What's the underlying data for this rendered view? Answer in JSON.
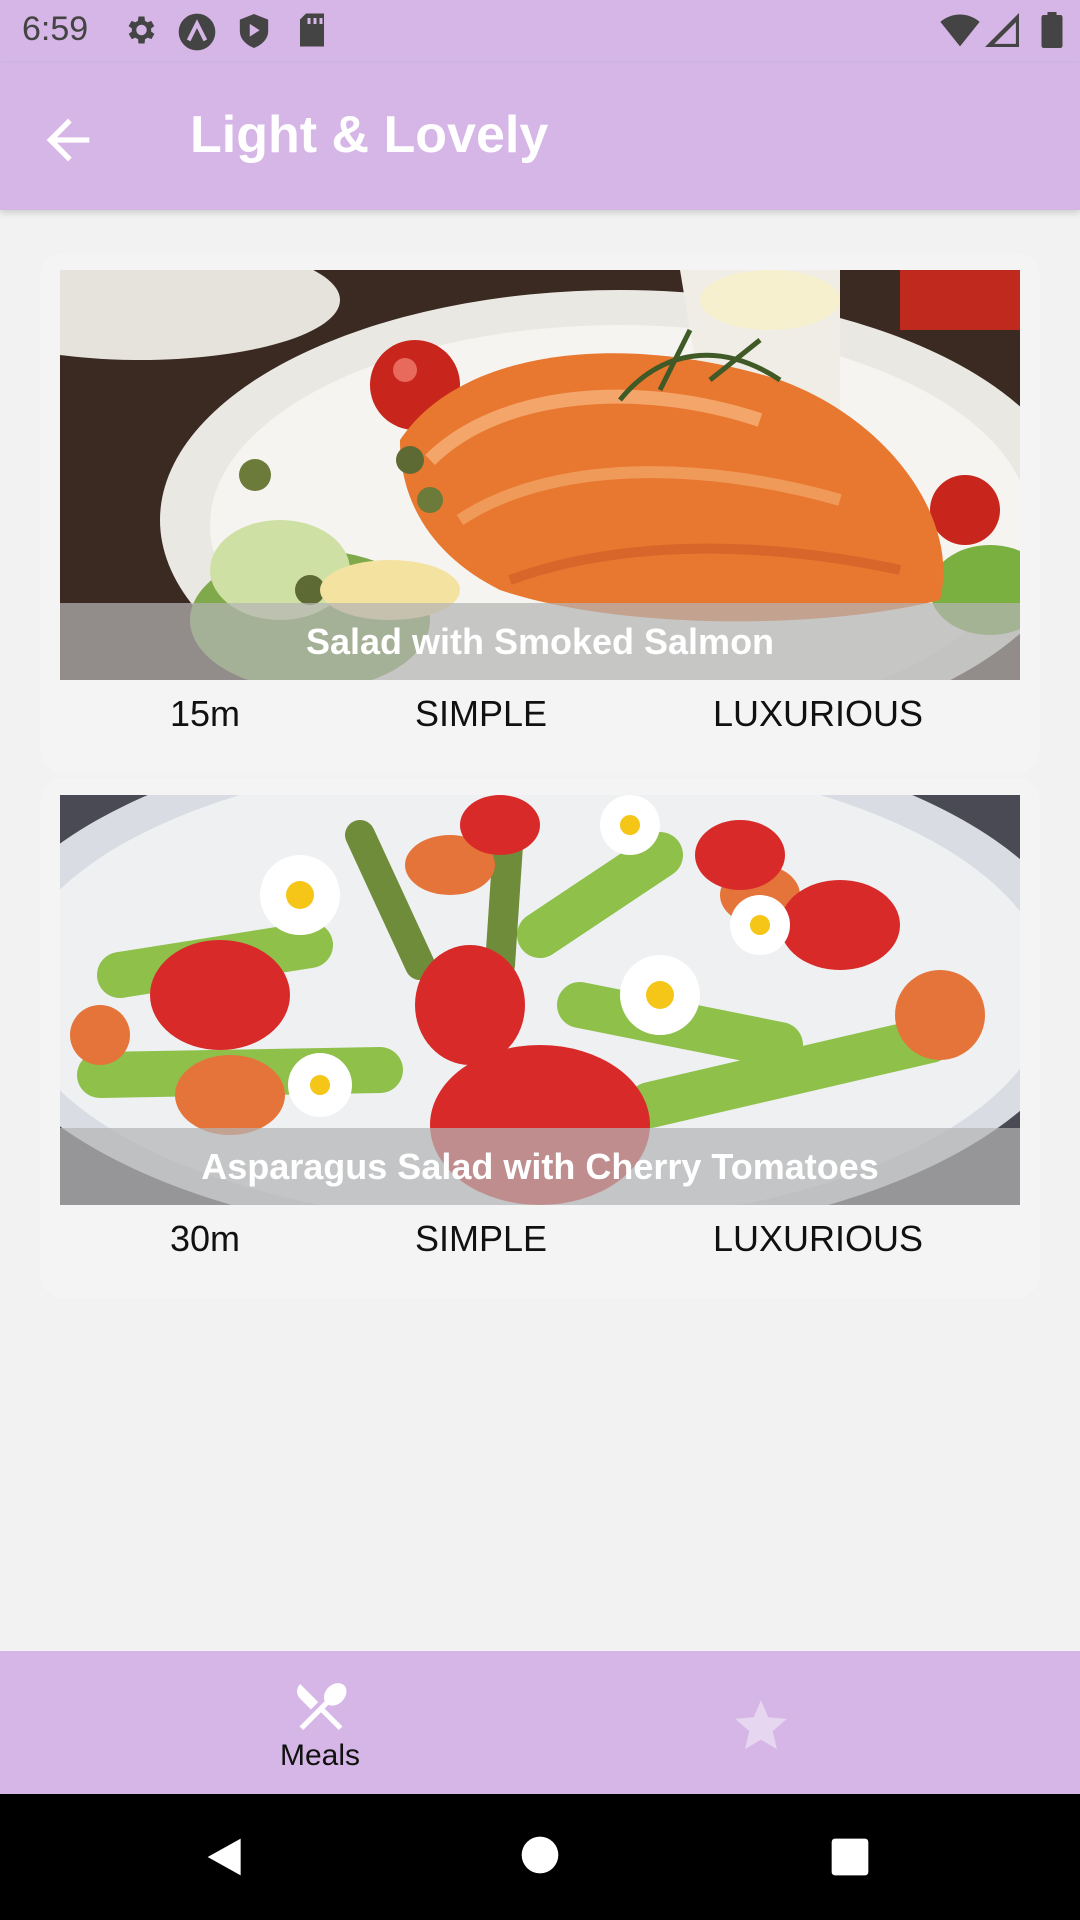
{
  "status_bar": {
    "time": "6:59",
    "left_icons": [
      "settings-icon",
      "app-a-icon",
      "shield-play-icon",
      "sd-card-icon"
    ],
    "right_icons": [
      "wifi-icon",
      "signal-icon",
      "battery-icon"
    ]
  },
  "app_bar": {
    "title": "Light & Lovely",
    "back_icon": "arrow-back-icon"
  },
  "meals": [
    {
      "title": "Salad with Smoked Salmon",
      "duration": "15m",
      "complexity": "SIMPLE",
      "affordability": "LUXURIOUS"
    },
    {
      "title": "Asparagus Salad with Cherry Tomatoes",
      "duration": "30m",
      "complexity": "SIMPLE",
      "affordability": "LUXURIOUS"
    }
  ],
  "bottom_nav": {
    "items": [
      {
        "label": "Meals",
        "icon": "fork-knife-icon",
        "active": true
      },
      {
        "label": "",
        "icon": "star-icon",
        "active": false
      }
    ]
  },
  "colors": {
    "app_bar": "#d5b6e6",
    "background": "#f2f2f2",
    "title_text": "#ffffff"
  }
}
